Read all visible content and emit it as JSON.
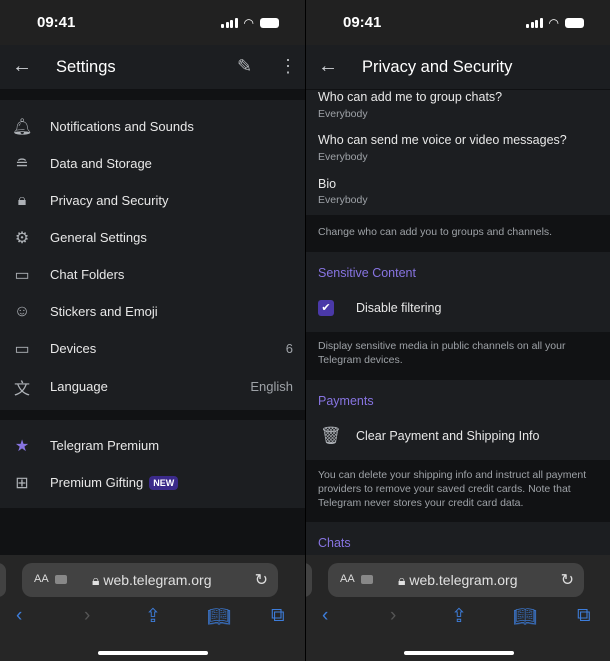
{
  "status": {
    "time": "09:41"
  },
  "left": {
    "header": {
      "title": "Settings",
      "back_icon": "arrow-left",
      "edit_icon": "pencil",
      "more_icon": "more-vertical"
    },
    "items": [
      {
        "label": "Notifications and Sounds",
        "icon": "bell"
      },
      {
        "label": "Data and Storage",
        "icon": "database"
      },
      {
        "label": "Privacy and Security",
        "icon": "lock"
      },
      {
        "label": "General Settings",
        "icon": "gear"
      },
      {
        "label": "Chat Folders",
        "icon": "folder"
      },
      {
        "label": "Stickers and Emoji",
        "icon": "sticker"
      },
      {
        "label": "Devices",
        "icon": "devices",
        "value": "6"
      },
      {
        "label": "Language",
        "icon": "translate",
        "value": "English"
      }
    ],
    "premium": [
      {
        "label": "Telegram Premium",
        "icon": "star"
      },
      {
        "label": "Premium Gifting",
        "icon": "gift",
        "badge": "NEW"
      }
    ]
  },
  "right": {
    "header": {
      "title": "Privacy and Security",
      "back_icon": "arrow-left"
    },
    "privacy_items": [
      {
        "title": "Who can add me to group chats?",
        "value": "Everybody"
      },
      {
        "title": "Who can send me voice or video messages?",
        "value": "Everybody"
      },
      {
        "title": "Bio",
        "value": "Everybody"
      }
    ],
    "privacy_hint": "Change who can add you to groups and channels.",
    "sensitive": {
      "heading": "Sensitive Content",
      "checkbox_label": "Disable filtering",
      "checked": true,
      "hint": "Display sensitive media in public channels on all your Telegram devices."
    },
    "payments": {
      "heading": "Payments",
      "action": "Clear Payment and Shipping Info",
      "icon": "trash",
      "hint": "You can delete your shipping info and instruct all payment providers to remove your saved credit cards. Note that Telegram never stores your credit card data."
    },
    "chats": {
      "heading": "Chats"
    }
  },
  "browser": {
    "aa": "AA",
    "url": "web.telegram.org"
  },
  "colors": {
    "accent": "#8774e1",
    "safari_blue": "#3d7ddb",
    "badge": "#3b2a8a"
  }
}
